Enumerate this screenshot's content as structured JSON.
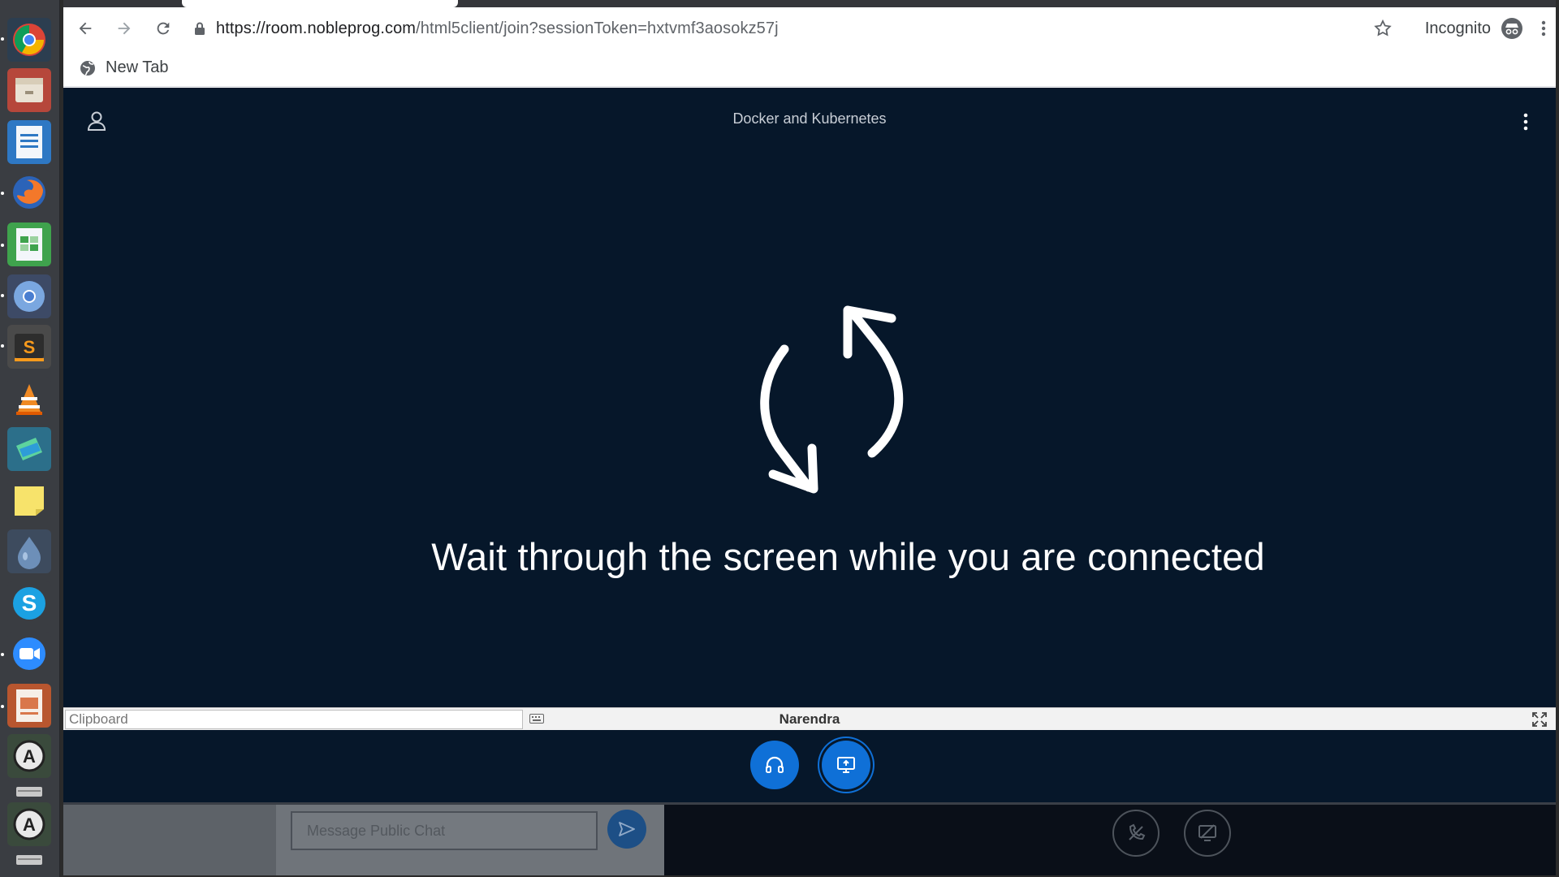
{
  "browser": {
    "url_host": "https://room.nobleprog.com",
    "url_path": "/html5client/join?sessionToken=hxtvmf3aosokz57j",
    "incognito_label": "Incognito",
    "bookmark_label": "New Tab"
  },
  "launcher": {
    "apps": [
      "chrome-icon",
      "files-icon",
      "writer-icon",
      "firefox-icon",
      "calc-icon",
      "chromium-icon",
      "sublime-icon",
      "vlc-icon",
      "teamviewer-icon",
      "sticky-notes-icon",
      "drop-icon",
      "skype-icon",
      "zoom-icon",
      "impress-icon",
      "software-updater-icon",
      "drive-icon",
      "software-center-icon",
      "drive-icon-2"
    ]
  },
  "session": {
    "title": "Docker and Kubernetes",
    "wait_message": "Wait through the screen while you are connected"
  },
  "clipboard": {
    "placeholder": "Clipboard",
    "viewer_name": "Narendra"
  },
  "chat": {
    "placeholder": "Message Public Chat"
  },
  "colors": {
    "page_bg": "#06172a",
    "accent": "#0f70d7"
  }
}
